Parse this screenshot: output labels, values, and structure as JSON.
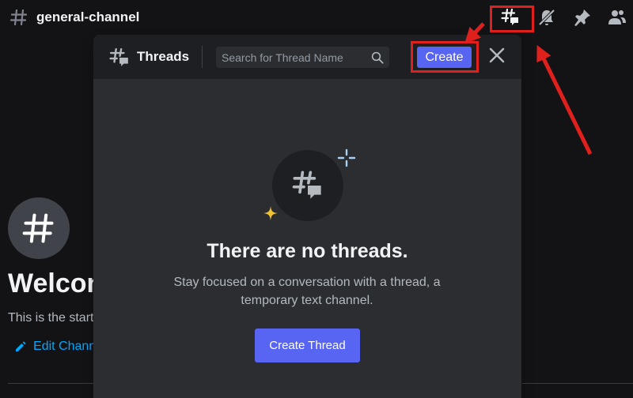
{
  "topbar": {
    "channel_name": "general-channel",
    "icons": [
      "hashtag-icon",
      "threads-icon",
      "notification-muted-icon",
      "pin-icon",
      "member-list-icon"
    ]
  },
  "background": {
    "welcome_title": "Welcome to #general-channel!",
    "start_text": "This is the start of the #general-channel channel.",
    "edit_channel_label": "Edit Channel"
  },
  "threads_popout": {
    "title": "Threads",
    "search": {
      "placeholder": "Search for Thread Name",
      "value": ""
    },
    "create_label": "Create",
    "empty": {
      "title": "There are no threads.",
      "description": "Stay focused on a conversation with a thread, a temporary text channel.",
      "button_label": "Create Thread"
    }
  },
  "colors": {
    "accent": "#5865f2",
    "annotation": "#e0201c",
    "link": "#00a8fc",
    "sparkle_blue": "#a7d1f5",
    "sparkle_yellow": "#f0c330"
  }
}
